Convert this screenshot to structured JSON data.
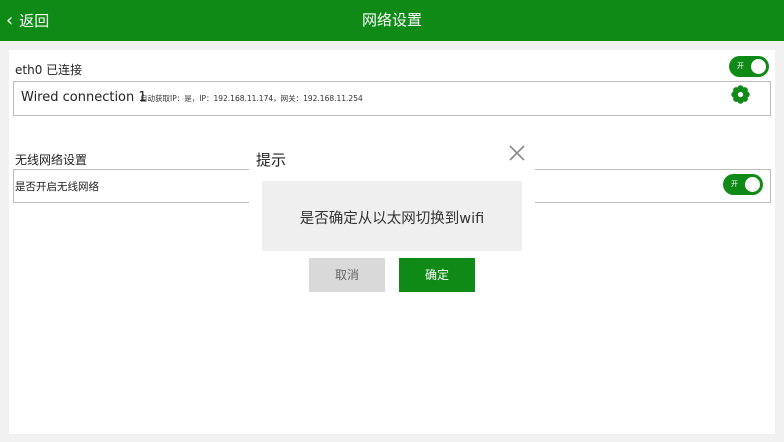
{
  "header": {
    "back_label": "返回",
    "title": "网络设置"
  },
  "ethernet": {
    "label": "eth0 已连接",
    "toggle_label": "开",
    "connection_name": "Wired connection 1",
    "connection_detail": "自动获取IP：是，IP：192.168.11.174，网关：192.168.11.254",
    "settings_icon": "gear-icon"
  },
  "wireless": {
    "section_title": "无线网络设置",
    "row_label": "是否开启无线网络",
    "toggle_label": "开"
  },
  "dialog": {
    "title": "提示",
    "message": "是否确定从以太网切换到wifi",
    "cancel_label": "取消",
    "confirm_label": "确定",
    "close_icon": "close-icon"
  },
  "colors": {
    "accent": "#0f8a17",
    "background": "#f1f1f1",
    "cancel_button": "#d9d9d9",
    "message_box": "#efefef"
  }
}
